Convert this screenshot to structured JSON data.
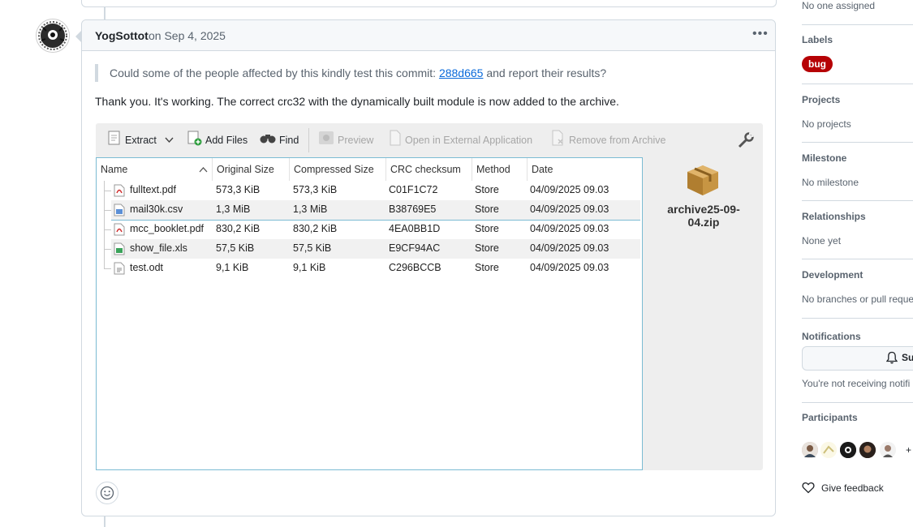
{
  "comment": {
    "author": "YogSottot",
    "date": "on Sep 4, 2025",
    "quote_before": "Could some of the people affected by this kindly test this commit: ",
    "quote_link": "288d665",
    "quote_after": " and report their results?",
    "body": "Thank you. It's working. The correct crc32 with the dynamically built module is now added to the archive."
  },
  "archive_app": {
    "toolbar": {
      "extract": "Extract",
      "add_files": "Add Files",
      "find": "Find",
      "preview": "Preview",
      "open_external": "Open in External Application",
      "remove": "Remove from Archive"
    },
    "columns": [
      "Name",
      "Original Size",
      "Compressed Size",
      "CRC checksum",
      "Method",
      "Date"
    ],
    "rows": [
      {
        "name": "fulltext.pdf",
        "orig": "573,3 KiB",
        "comp": "573,3 KiB",
        "crc": "C01F1C72",
        "method": "Store",
        "date": "04/09/2025 09.03",
        "icon": "pdf-file-icon"
      },
      {
        "name": "mail30k.csv",
        "orig": "1,3 MiB",
        "comp": "1,3 MiB",
        "crc": "B38769E5",
        "method": "Store",
        "date": "04/09/2025 09.03",
        "icon": "csv-file-icon"
      },
      {
        "name": "mcc_booklet.pdf",
        "orig": "830,2 KiB",
        "comp": "830,2 KiB",
        "crc": "4EA0BB1D",
        "method": "Store",
        "date": "04/09/2025 09.03",
        "icon": "pdf-file-icon"
      },
      {
        "name": "show_file.xls",
        "orig": "57,5 KiB",
        "comp": "57,5 KiB",
        "crc": "E9CF94AC",
        "method": "Store",
        "date": "04/09/2025 09.03",
        "icon": "spreadsheet-file-icon"
      },
      {
        "name": "test.odt",
        "orig": "9,1 KiB",
        "comp": "9,1 KiB",
        "crc": "C296BCCB",
        "method": "Store",
        "date": "04/09/2025 09.03",
        "icon": "document-file-icon"
      }
    ],
    "archive_name": "archive25-09-04.zip"
  },
  "sidebar": {
    "assignees_value": "No one assigned",
    "labels_heading": "Labels",
    "label_bug": "bug",
    "projects_heading": "Projects",
    "projects_value": "No projects",
    "milestone_heading": "Milestone",
    "milestone_value": "No milestone",
    "relationships_heading": "Relationships",
    "relationships_value": "None yet",
    "development_heading": "Development",
    "development_value": "No branches or pull reque",
    "notifications_heading": "Notifications",
    "subscribe_label": "Su",
    "notifications_value": "You're not receiving notifi",
    "participants_heading": "Participants",
    "participants_more": "+",
    "feedback": "Give feedback"
  },
  "colors": {
    "bug_label": "#b60205",
    "link": "#0969da",
    "border": "#d1d9e0",
    "list_border": "#7bbbd3"
  }
}
